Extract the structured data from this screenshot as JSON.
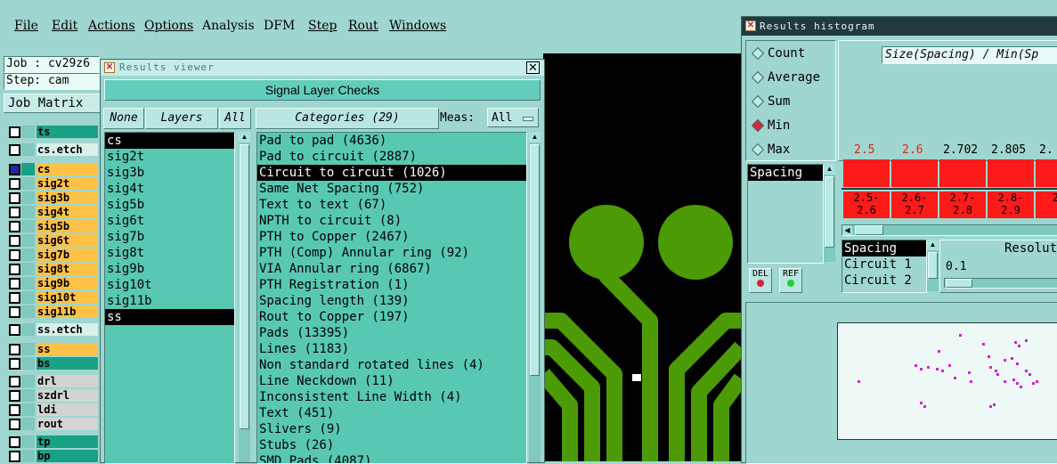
{
  "menu": [
    "File",
    "Edit",
    "Actions",
    "Options",
    "Analysis",
    "DFM",
    "Step",
    "Rout",
    "Windows"
  ],
  "job": {
    "job_label": "Job : cv29z6",
    "step_label": "Step: cam",
    "matrix_button": "Job Matrix"
  },
  "layers": [
    {
      "name": "ts",
      "color": "#19a185"
    },
    {
      "name": "cs.etch",
      "color": "#d9f0ed"
    },
    {
      "name": "cs",
      "color": "#ffc146"
    },
    {
      "name": "sig2t",
      "color": "#ffc146"
    },
    {
      "name": "sig3b",
      "color": "#ffc146"
    },
    {
      "name": "sig4t",
      "color": "#ffc146"
    },
    {
      "name": "sig5b",
      "color": "#ffc146"
    },
    {
      "name": "sig6t",
      "color": "#ffc146"
    },
    {
      "name": "sig7b",
      "color": "#ffc146"
    },
    {
      "name": "sig8t",
      "color": "#ffc146"
    },
    {
      "name": "sig9b",
      "color": "#ffc146"
    },
    {
      "name": "sig10t",
      "color": "#ffc146"
    },
    {
      "name": "sig11b",
      "color": "#ffc146"
    },
    {
      "name": "ss.etch",
      "color": "#d9f0ed"
    },
    {
      "name": "ss",
      "color": "#ffc146"
    },
    {
      "name": "bs",
      "color": "#19a185"
    },
    {
      "name": "drl",
      "color": "#d3d3d3"
    },
    {
      "name": "szdrl",
      "color": "#d3d3d3"
    },
    {
      "name": "ldi",
      "color": "#d3d3d3"
    },
    {
      "name": "rout",
      "color": "#d3d3d3"
    },
    {
      "name": "tp",
      "color": "#19a185"
    },
    {
      "name": "bp",
      "color": "#19a185"
    }
  ],
  "results_viewer": {
    "title": "Results viewer",
    "header": "Signal Layer Checks",
    "none_btn": "None",
    "layers_btn": "Layers",
    "all_btn": "All",
    "categories_btn": "Categories (29)",
    "meas_label": "Meas:",
    "meas_value": "All",
    "layer_list": [
      "cs",
      "sig2t",
      "sig3b",
      "sig4t",
      "sig5b",
      "sig6t",
      "sig7b",
      "sig8t",
      "sig9b",
      "sig10t",
      "sig11b",
      "ss"
    ],
    "categories": [
      "Pad to pad (4636)",
      "Pad to circuit (2887)",
      "Circuit to circuit (1026)",
      "Same Net Spacing (752)",
      "Text to text (67)",
      "NPTH to circuit (8)",
      "PTH to Copper (2467)",
      "PTH (Comp) Annular ring (92)",
      "VIA Annular ring (6867)",
      "PTH Registration (1)",
      "Spacing length (139)",
      "Rout to Copper (197)",
      "Pads (13395)",
      "Lines (1183)",
      "Non standard rotated lines (4)",
      "Line Neckdown (11)",
      "Inconsistent Line Width (4)",
      "Text (451)",
      "Slivers (9)",
      "Stubs (26)",
      "SMD Pads (4087)"
    ]
  },
  "histogram": {
    "title": "Results histogram",
    "radios": [
      "Count",
      "Average",
      "Sum",
      "Min",
      "Max"
    ],
    "selected_radio": "Min",
    "header_text": "Size(Spacing) / Min(Sp",
    "list1": [
      "Spacing"
    ],
    "list2": [
      "Spacing",
      "Circuit 1",
      "Circuit 2"
    ],
    "resolution_label": "Resolut",
    "resolution_value": "0.1",
    "del_btn": "DEL",
    "ref_btn": "REF",
    "bar_values": [
      {
        "label": "2.5",
        "color": "#e02020"
      },
      {
        "label": "2.6",
        "color": "#e02020"
      },
      {
        "label": "2.702",
        "color": "#000000"
      },
      {
        "label": "2.805",
        "color": "#000000"
      },
      {
        "label": "2.",
        "color": "#000000"
      }
    ],
    "bins": [
      "2.5-\n2.6",
      "2.6-\n2.7",
      "2.7-\n2.8",
      "2.8-\n2.9",
      "2."
    ]
  }
}
